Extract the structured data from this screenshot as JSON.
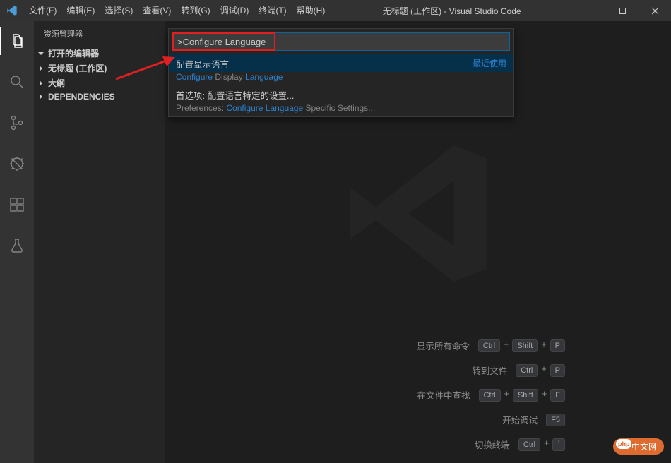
{
  "titlebar": {
    "menus": [
      "文件(F)",
      "编辑(E)",
      "选择(S)",
      "查看(V)",
      "转到(G)",
      "调试(D)",
      "终端(T)",
      "帮助(H)"
    ],
    "title": "无标题 (工作区) - Visual Studio Code"
  },
  "sidebar": {
    "header": "资源管理器",
    "sections": [
      {
        "label": "打开的编辑器",
        "expanded": true,
        "bold": true
      },
      {
        "label": "无标题 (工作区)",
        "expanded": false,
        "bold": true
      },
      {
        "label": "大纲",
        "expanded": false,
        "bold": true
      },
      {
        "label": "DEPENDENCIES",
        "expanded": false,
        "bold": true
      }
    ]
  },
  "palette": {
    "input": ">Configure Language",
    "recent_label": "最近使用",
    "items": [
      {
        "label_cn": "配置显示语言",
        "label_en_pre": "Configure",
        "label_en_mid": " Display ",
        "label_en_post": "Language",
        "selected": true
      },
      {
        "label_cn": "首选项: 配置语言特定的设置...",
        "label_en_pre2": "Preferences: ",
        "label_en_hl1": "Configure",
        "label_en_mid2": " ",
        "label_en_hl2": "Language",
        "label_en_post2": " Specific Settings...",
        "selected": false
      }
    ]
  },
  "hints": [
    {
      "label": "显示所有命令",
      "keys": [
        "Ctrl",
        "+",
        "Shift",
        "+",
        "P"
      ]
    },
    {
      "label": "转到文件",
      "keys": [
        "Ctrl",
        "+",
        "P"
      ]
    },
    {
      "label": "在文件中查找",
      "keys": [
        "Ctrl",
        "+",
        "Shift",
        "+",
        "F"
      ]
    },
    {
      "label": "开始调试",
      "keys": [
        "F5"
      ]
    },
    {
      "label": "切换终端",
      "keys": [
        "Ctrl",
        "+",
        "`"
      ]
    }
  ],
  "watermark": "中文网"
}
